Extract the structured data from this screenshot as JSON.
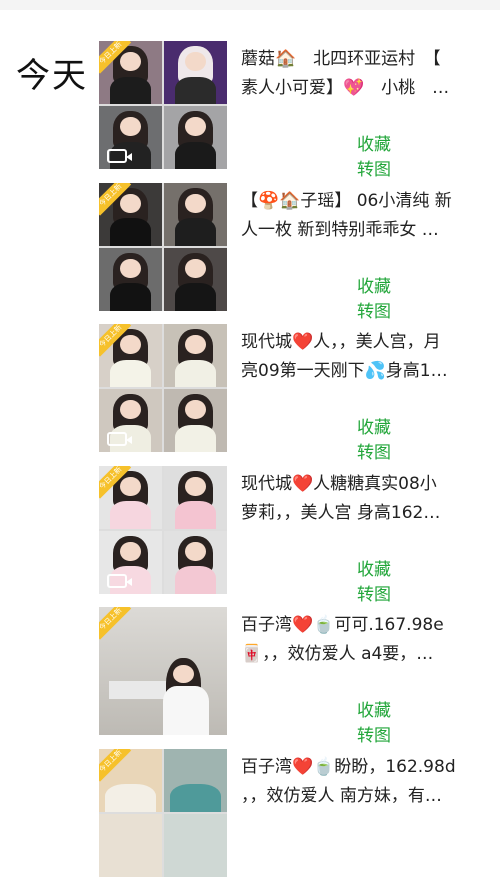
{
  "day_label": "今天",
  "badge_text": "今日上新",
  "actions": {
    "favorite": "收藏",
    "repost": "转图"
  },
  "colors": {
    "action_green": "#22a63a",
    "badge_yellow": "#f6c12b"
  },
  "items": [
    {
      "line1": "蘑菇🏠　北四环亚运村　【",
      "line2": "素人小可爱】💖　小桃　…",
      "layout": "grid",
      "video": true
    },
    {
      "line1": "【🍄🏠子瑶】 06小清纯 新",
      "line2": "人一枚 新到特别乖乖女 …",
      "layout": "grid",
      "video": false
    },
    {
      "line1": "现代城❤️人，，美人宫，月",
      "line2": "亮09第一天刚下💦身高1…",
      "layout": "grid",
      "video": true
    },
    {
      "line1": "现代城❤️人糖糖真实08小",
      "line2": "萝莉，，美人宫 身高162…",
      "layout": "grid",
      "video": true
    },
    {
      "line1": "百子湾❤️🍵可可.167.98e",
      "line2": "🀄，，效仿爱人 a4要，…",
      "layout": "single",
      "video": false
    },
    {
      "line1": "百子湾❤️🍵盼盼，162.98d",
      "line2": "，，效仿爱人 南方妹，有…",
      "layout": "grid",
      "video": false
    }
  ]
}
